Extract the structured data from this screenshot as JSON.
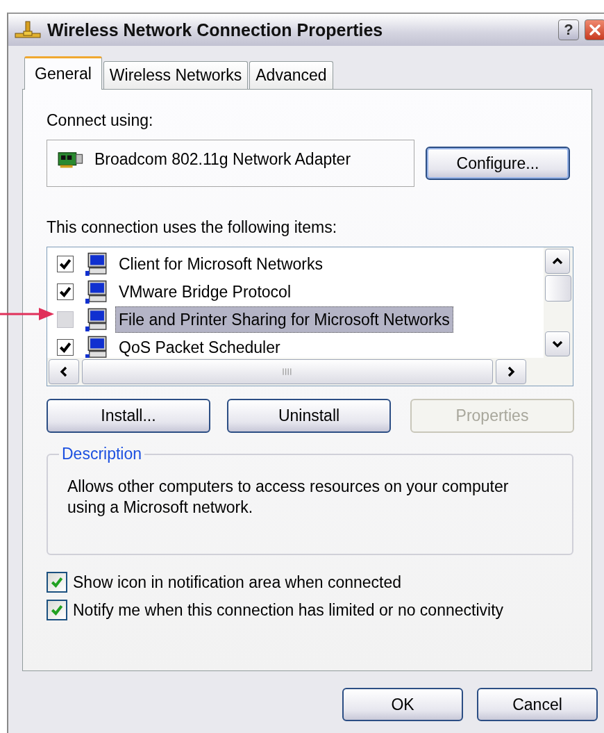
{
  "window": {
    "title": "Wireless Network Connection Properties",
    "help_button": "?"
  },
  "tabs": [
    {
      "label": "General",
      "selected": true
    },
    {
      "label": "Wireless Networks",
      "selected": false
    },
    {
      "label": "Advanced",
      "selected": false
    }
  ],
  "connect_using": {
    "label": "Connect using:",
    "adapter": "Broadcom 802.11g Network Adapter",
    "button": "Configure..."
  },
  "components": {
    "label": "This connection uses the following items:",
    "items": [
      {
        "label": "Client for Microsoft Networks",
        "checked": true,
        "selected": false
      },
      {
        "label": "VMware Bridge Protocol",
        "checked": true,
        "selected": false
      },
      {
        "label": "File and Printer Sharing for Microsoft Networks",
        "checked": false,
        "selected": true
      },
      {
        "label": "QoS Packet Scheduler",
        "checked": true,
        "selected": false
      }
    ],
    "buttons": [
      {
        "label": "Install...",
        "disabled": false
      },
      {
        "label": "Uninstall",
        "disabled": false
      },
      {
        "label": "Properties",
        "disabled": true
      }
    ]
  },
  "description": {
    "title": "Description",
    "text": "Allows other computers to access resources on your computer using a Microsoft network."
  },
  "options": [
    {
      "label": "Show icon in notification area when connected",
      "checked": true
    },
    {
      "label": "Notify me when this connection has limited or no connectivity",
      "checked": true
    }
  ],
  "dialog_buttons": [
    {
      "label": "OK"
    },
    {
      "label": "Cancel"
    }
  ]
}
